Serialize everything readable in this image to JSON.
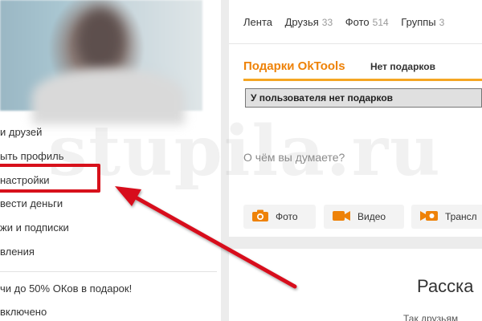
{
  "profile_menu": {
    "items": [
      {
        "label": "и друзей"
      },
      {
        "label": "ыть профиль"
      },
      {
        "label": "настройки"
      },
      {
        "label": "вести деньги"
      },
      {
        "label": "жи и подписки"
      },
      {
        "label": "вления"
      }
    ],
    "promo": "чи до 50% ОКов в подарок!",
    "promo_status": "включено"
  },
  "tabs": [
    {
      "label": "Лента",
      "count": ""
    },
    {
      "label": "Друзья",
      "count": "33"
    },
    {
      "label": "Фото",
      "count": "514"
    },
    {
      "label": "Группы",
      "count": "3"
    }
  ],
  "gifts": {
    "title": "Подарки OkTools",
    "status": "Нет подарков",
    "message": "У пользователя нет подарков"
  },
  "post": {
    "placeholder": "О чём вы думаете?"
  },
  "media_buttons": [
    {
      "label": "Фото",
      "icon": "camera-icon"
    },
    {
      "label": "Видео",
      "icon": "video-camera-icon"
    },
    {
      "label": "Трансл",
      "icon": "broadcast-icon"
    }
  ],
  "story": {
    "title": "Расска",
    "subtitle": "Так друзьям"
  },
  "watermark": "stupila.ru",
  "colors": {
    "accent": "#ee8208",
    "highlight": "#d7111b",
    "gift_underline": "#f5a623"
  }
}
